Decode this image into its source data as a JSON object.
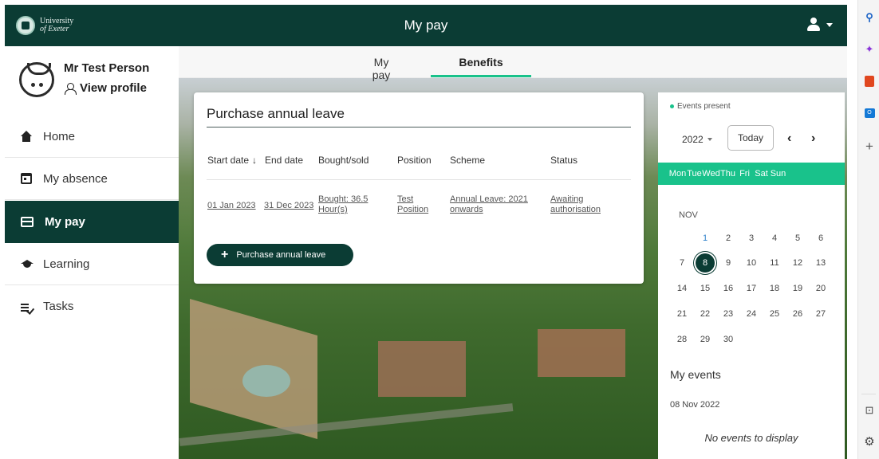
{
  "header": {
    "logo_line1": "University",
    "logo_line2": "of Exeter",
    "title": "My pay"
  },
  "sidebar": {
    "profile_name": "Mr Test Person",
    "view_profile": "View profile",
    "items": [
      {
        "label": "Home",
        "icon": "home-icon"
      },
      {
        "label": "My absence",
        "icon": "calendar-icon"
      },
      {
        "label": "My pay",
        "icon": "card-icon",
        "active": true
      },
      {
        "label": "Learning",
        "icon": "graduation-cap-icon"
      },
      {
        "label": "Tasks",
        "icon": "tasks-icon"
      }
    ]
  },
  "tabs": [
    {
      "label": "My pay"
    },
    {
      "label": "Benefits",
      "active": true
    }
  ],
  "leave_card": {
    "title": "Purchase annual leave",
    "columns": [
      "Start date",
      "End date",
      "Bought/sold",
      "Position",
      "Scheme",
      "Status"
    ],
    "sort_indicator": "↓",
    "rows": [
      {
        "start_date": "01 Jan 2023",
        "end_date": "31 Dec 2023",
        "bought_sold": [
          "Bought: 36.5",
          "Hour(s)"
        ],
        "position": [
          "Test",
          "Position"
        ],
        "scheme": [
          "Annual Leave: 2021",
          "onwards"
        ],
        "status": [
          "Awaiting",
          "authorisation"
        ]
      }
    ],
    "purchase_button": "Purchase annual leave"
  },
  "calendar": {
    "legend": "Events present",
    "year": "2022",
    "today_label": "Today",
    "days_of_week": [
      "Mon",
      "Tue",
      "Wed",
      "Thu",
      "Fri",
      "Sat",
      "Sun"
    ],
    "month": "NOV",
    "selected_day": 8,
    "weeks": [
      [
        "",
        "1",
        "2",
        "3",
        "4",
        "5",
        "6"
      ],
      [
        "7",
        "8",
        "9",
        "10",
        "11",
        "12",
        "13"
      ],
      [
        "14",
        "15",
        "16",
        "17",
        "18",
        "19",
        "20"
      ],
      [
        "21",
        "22",
        "23",
        "24",
        "25",
        "26",
        "27"
      ],
      [
        "28",
        "29",
        "30",
        "",
        "",
        "",
        ""
      ]
    ],
    "my_events_title": "My events",
    "events_date": "08 Nov 2022",
    "no_events": "No events to display"
  },
  "colors": {
    "header": "#0b3c34",
    "accent": "#19c28b"
  }
}
